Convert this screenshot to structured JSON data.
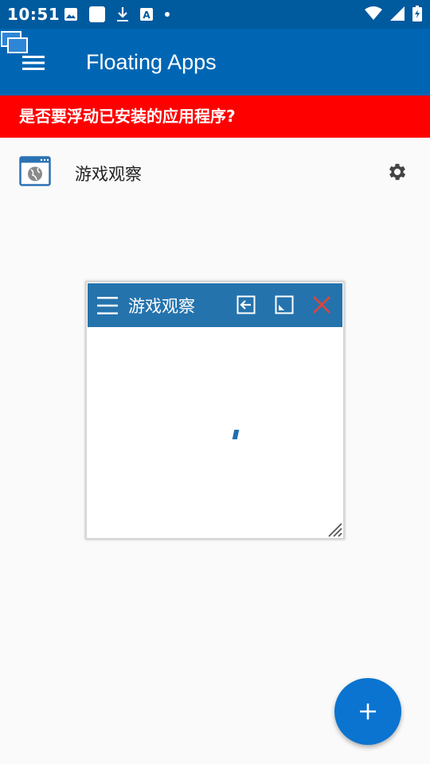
{
  "status_bar": {
    "time": "10:51",
    "left_icons": [
      "image-icon",
      "blank-square-icon",
      "download-icon",
      "text-a-icon",
      "dot-icon"
    ],
    "right_icons": [
      "wifi-icon",
      "signal-icon",
      "battery-charging-icon"
    ]
  },
  "app_bar": {
    "title": "Floating Apps",
    "menu_icon": "hamburger-menu-icon",
    "color": "#0066b4"
  },
  "banner": {
    "text": "是否要浮动已安装的应用程序?",
    "color": "#ff0000"
  },
  "list": {
    "items": [
      {
        "label": "游戏观察",
        "icon": "browser-globe-icon",
        "action_icon": "gear-icon"
      }
    ]
  },
  "floating_window": {
    "title": "游戏观察",
    "titlebar_color": "#2573ad",
    "buttons": [
      "back-arrow-icon",
      "minimize-icon",
      "close-icon"
    ],
    "loading": true
  },
  "fab": {
    "icon": "plus-icon",
    "color": "#0a74d0"
  }
}
